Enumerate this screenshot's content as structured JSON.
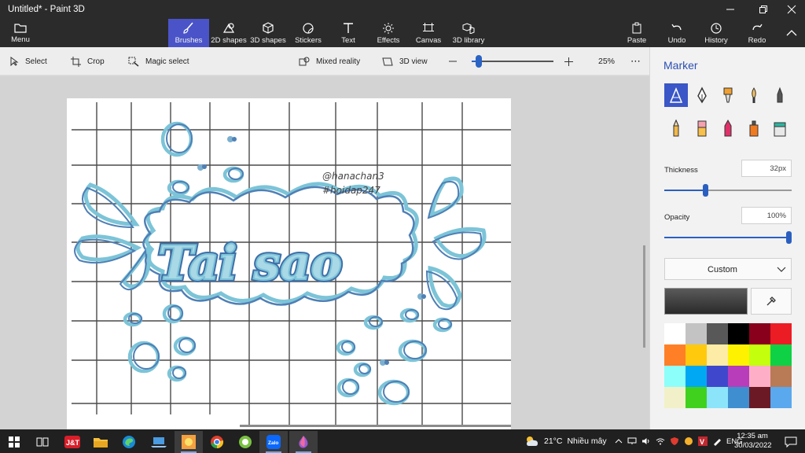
{
  "window": {
    "title": "Untitled* - Paint 3D",
    "controls": [
      "minimize-icon",
      "restore-icon",
      "close-icon"
    ]
  },
  "ribbon": {
    "menu_label": "Menu",
    "tabs": [
      {
        "label": "Brushes",
        "icon": "brush-icon",
        "active": true
      },
      {
        "label": "2D shapes",
        "icon": "2d-shapes-icon"
      },
      {
        "label": "3D shapes",
        "icon": "3d-shapes-icon"
      },
      {
        "label": "Stickers",
        "icon": "stickers-icon"
      },
      {
        "label": "Text",
        "icon": "text-icon"
      },
      {
        "label": "Effects",
        "icon": "effects-icon"
      },
      {
        "label": "Canvas",
        "icon": "canvas-icon"
      },
      {
        "label": "3D library",
        "icon": "3d-library-icon"
      }
    ],
    "actions": [
      {
        "label": "Paste",
        "icon": "paste-icon"
      },
      {
        "label": "Undo",
        "icon": "undo-icon"
      },
      {
        "label": "History",
        "icon": "history-icon"
      },
      {
        "label": "Redo",
        "icon": "redo-icon"
      }
    ]
  },
  "toolbar": {
    "select_label": "Select",
    "crop_label": "Crop",
    "magic_select_label": "Magic select",
    "mixed_reality_label": "Mixed reality",
    "view_3d_label": "3D view",
    "zoom_value": "25%",
    "zoom_fraction": 0.08,
    "more_label": "⋯"
  },
  "canvas": {
    "handle_line1": "@hanachan3",
    "handle_line2": "#hoidap247",
    "drawing_text": "Tai sao"
  },
  "panel": {
    "title": "Marker",
    "tools": [
      "marker-icon",
      "calligraphy-pen-icon",
      "oil-brush-icon",
      "watercolor-icon",
      "pixel-pen-icon",
      "pencil-icon",
      "eraser-icon",
      "crayon-icon",
      "spray-can-icon",
      "fill-bucket-icon"
    ],
    "thickness_label": "Thickness",
    "thickness_value": "32px",
    "thickness_fraction": 0.32,
    "opacity_label": "Opacity",
    "opacity_value": "100%",
    "opacity_fraction": 1.0,
    "color_mode": "Custom",
    "palette": [
      "#ffffff",
      "#c3c3c3",
      "#585858",
      "#000000",
      "#88001b",
      "#ec1c24",
      "#ff7f27",
      "#ffc90e",
      "#fdeca6",
      "#fff200",
      "#c4ff0e",
      "#0ed145",
      "#8cfffb",
      "#00a8f3",
      "#3f48cc",
      "#b83dba",
      "#ffaec8",
      "#b97a56",
      "#f2f0c8",
      "#3fd11e",
      "#8ce4fb",
      "#3f8fd0",
      "#6b1a25",
      "#5aa8ee"
    ]
  },
  "taskbar": {
    "weather_temp": "21°C",
    "weather_text": "Nhiều mây",
    "language": "ENG",
    "time": "12:35 am",
    "date": "30/03/2022",
    "apps": [
      "start-icon",
      "task-view-icon",
      "jt-app-icon",
      "file-explorer-icon",
      "edge-icon",
      "laptop-app-icon",
      "paint-app-icon",
      "chrome-icon",
      "green-app-icon",
      "zalo-icon",
      "paint-3d-icon"
    ]
  }
}
